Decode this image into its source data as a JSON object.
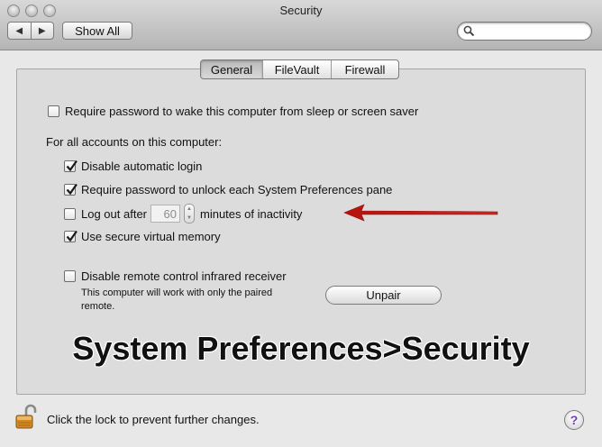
{
  "window": {
    "title": "Security",
    "show_all_label": "Show All",
    "search": {
      "value": "",
      "placeholder": ""
    }
  },
  "tabs": [
    {
      "label": "General",
      "active": true
    },
    {
      "label": "FileVault",
      "active": false
    },
    {
      "label": "Firewall",
      "active": false
    }
  ],
  "general": {
    "require_password_wake": {
      "label": "Require password to wake this computer from sleep or screen saver",
      "checked": false
    },
    "accounts_heading": "For all accounts on this computer:",
    "disable_auto_login": {
      "label": "Disable automatic login",
      "checked": true
    },
    "require_password_unlock": {
      "label": "Require password to unlock each System Preferences pane",
      "checked": true
    },
    "logout": {
      "prefix": "Log out after",
      "minutes": "60",
      "suffix": "minutes of inactivity",
      "checked": false
    },
    "secure_vm": {
      "label": "Use secure virtual memory",
      "checked": true
    },
    "disable_ir": {
      "label": "Disable remote control infrared receiver",
      "checked": false
    },
    "ir_note": "This computer will work with only the paired remote.",
    "unpair_label": "Unpair"
  },
  "caption": "System Preferences>Security",
  "footer": {
    "lock_text": "Click the lock to prevent further changes.",
    "help_label": "?"
  },
  "colors": {
    "arrow": "#e0201b",
    "help_question": "#6a3fb8"
  }
}
